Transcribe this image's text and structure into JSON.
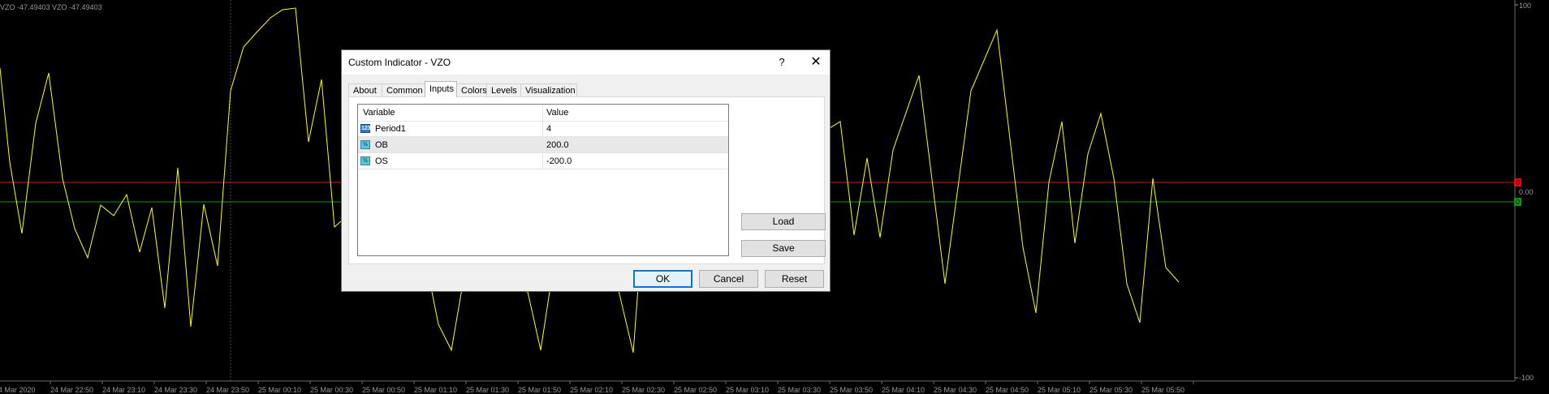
{
  "chart": {
    "header_text": "VZO -47.49403   VZO -47.49403",
    "y_labels": [
      "100",
      "0.00",
      "-100"
    ],
    "level_markers": [
      "0",
      "0"
    ],
    "x_labels": [
      "4 Mar 2020",
      "24 Mar 22:50",
      "24 Mar 23:10",
      "24 Mar 23:30",
      "24 Mar 23:50",
      "25 Mar 00:10",
      "25 Mar 00:30",
      "25 Mar 00:50",
      "25 Mar 01:10",
      "25 Mar 01:30",
      "25 Mar 01:50",
      "25 Mar 02:10",
      "25 Mar 02:30",
      "25 Mar 02:50",
      "25 Mar 03:10",
      "25 Mar 03:30",
      "25 Mar 03:50",
      "25 Mar 04:10",
      "25 Mar 04:30",
      "25 Mar 04:50",
      "25 Mar 05:10",
      "25 Mar 05:30",
      "25 Mar 05:50"
    ],
    "colors": {
      "background": "#000000",
      "line": "#ffff00",
      "upper_level": "#ff0000",
      "lower_level": "#00a000",
      "grid": "#4a4a4a",
      "text": "#9a9a9a"
    }
  },
  "dialog": {
    "title": "Custom Indicator - VZO",
    "help_label": "?",
    "close_label": "✕",
    "tabs": [
      {
        "label": "About"
      },
      {
        "label": "Common"
      },
      {
        "label": "Inputs",
        "active": true
      },
      {
        "label": "Colors"
      },
      {
        "label": "Levels"
      },
      {
        "label": "Visualization"
      }
    ],
    "table": {
      "headers": [
        "Variable",
        "Value"
      ],
      "rows": [
        {
          "icon": "int-icon",
          "icon_text": "123",
          "variable": "Period1",
          "value": "4"
        },
        {
          "icon": "double-icon",
          "icon_text": "½",
          "variable": "OB",
          "value": "200.0"
        },
        {
          "icon": "double-icon",
          "icon_text": "½",
          "variable": "OS",
          "value": "-200.0"
        }
      ]
    },
    "buttons": {
      "load": "Load",
      "save": "Save",
      "ok": "OK",
      "cancel": "Cancel",
      "reset": "Reset"
    }
  }
}
